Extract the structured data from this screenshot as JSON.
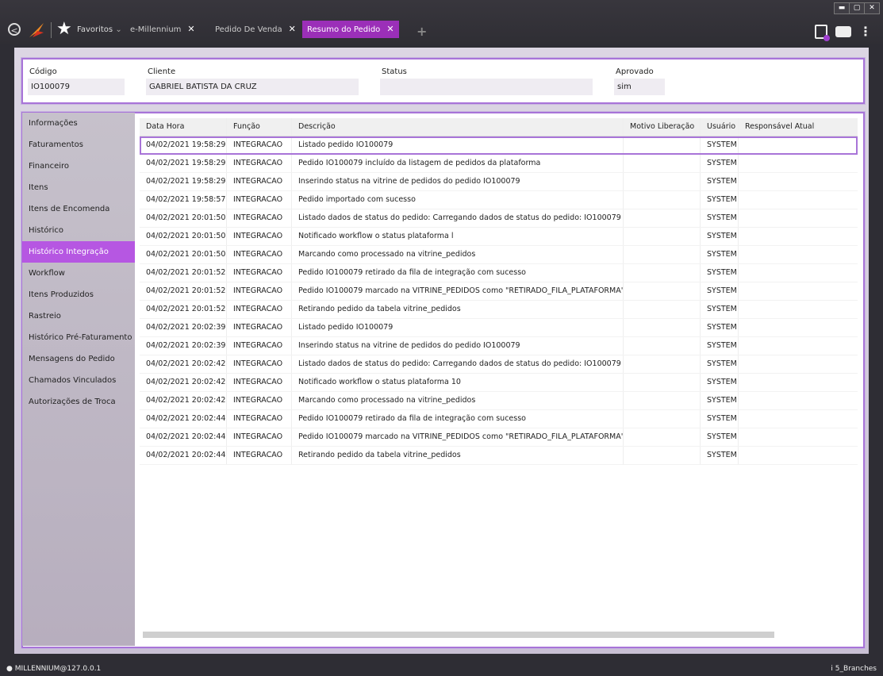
{
  "topbar": {
    "back": "⊖",
    "favorites": {
      "label": "Favoritos",
      "caret": "⌄"
    },
    "tabs": [
      {
        "label": "e-Millennium",
        "close": "✕"
      },
      {
        "label": "Pedido De Venda",
        "close": "✕"
      },
      {
        "label": "Resumo do Pedido",
        "close": "✕"
      }
    ],
    "add_tab": "+",
    "window_controls": [
      "▬",
      "▢",
      "✕"
    ],
    "menu_dots": "⋮"
  },
  "header": {
    "codigo_label": "Código",
    "codigo_value": "IO100079",
    "cliente_label": "Cliente",
    "cliente_value": "GABRIEL BATISTA DA CRUZ",
    "status_label": "Status",
    "status_value": "",
    "aprovado_label": "Aprovado",
    "aprovado_value": "sim"
  },
  "sidebar": {
    "items": [
      "Informações",
      "Faturamentos",
      "Financeiro",
      "Itens",
      "Itens de Encomenda",
      "Histórico",
      "Histórico Integração",
      "Workflow",
      "Itens Produzidos",
      "Rastreio",
      "Histórico Pré-Faturamento",
      "Mensagens do Pedido",
      "Chamados Vinculados",
      "Autorizações de Troca"
    ],
    "active_index": 6
  },
  "grid": {
    "columns": [
      "Data Hora",
      "Função",
      "Descrição",
      "Motivo Liberação",
      "Usuário",
      "Responsável Atual"
    ],
    "rows": [
      [
        "04/02/2021 19:58:29",
        "INTEGRACAO",
        "Listado pedido IO100079",
        "",
        "SYSTEM",
        ""
      ],
      [
        "04/02/2021 19:58:29",
        "INTEGRACAO",
        "Pedido IO100079 incluído da listagem de pedidos da plataforma",
        "",
        "SYSTEM",
        ""
      ],
      [
        "04/02/2021 19:58:29",
        "INTEGRACAO",
        "Inserindo status na vitrine de pedidos do pedido IO100079",
        "",
        "SYSTEM",
        ""
      ],
      [
        "04/02/2021 19:58:57",
        "INTEGRACAO",
        "Pedido importado com sucesso",
        "",
        "SYSTEM",
        ""
      ],
      [
        "04/02/2021 20:01:50",
        "INTEGRACAO",
        "Listado dados de status do pedido: Carregando dados de status do pedido: IO100079",
        "",
        "SYSTEM",
        ""
      ],
      [
        "04/02/2021 20:01:50",
        "INTEGRACAO",
        "Notificado workflow o status plataforma l",
        "",
        "SYSTEM",
        ""
      ],
      [
        "04/02/2021 20:01:50",
        "INTEGRACAO",
        "Marcando como processado na vitrine_pedidos",
        "",
        "SYSTEM",
        ""
      ],
      [
        "04/02/2021 20:01:52",
        "INTEGRACAO",
        "Pedido IO100079 retirado da fila de integração com sucesso",
        "",
        "SYSTEM",
        ""
      ],
      [
        "04/02/2021 20:01:52",
        "INTEGRACAO",
        "Pedido IO100079 marcado na VITRINE_PEDIDOS como \"RETIRADO_FILA_PLATAFORMA\"",
        "",
        "SYSTEM",
        ""
      ],
      [
        "04/02/2021 20:01:52",
        "INTEGRACAO",
        "Retirando pedido da tabela vitrine_pedidos",
        "",
        "SYSTEM",
        ""
      ],
      [
        "04/02/2021 20:02:39",
        "INTEGRACAO",
        "Listado pedido IO100079",
        "",
        "SYSTEM",
        ""
      ],
      [
        "04/02/2021 20:02:39",
        "INTEGRACAO",
        "Inserindo status na vitrine de pedidos do pedido IO100079",
        "",
        "SYSTEM",
        ""
      ],
      [
        "04/02/2021 20:02:42",
        "INTEGRACAO",
        "Listado dados de status do pedido: Carregando dados de status do pedido: IO100079",
        "",
        "SYSTEM",
        ""
      ],
      [
        "04/02/2021 20:02:42",
        "INTEGRACAO",
        "Notificado workflow o status plataforma 10",
        "",
        "SYSTEM",
        ""
      ],
      [
        "04/02/2021 20:02:42",
        "INTEGRACAO",
        "Marcando como processado na vitrine_pedidos",
        "",
        "SYSTEM",
        ""
      ],
      [
        "04/02/2021 20:02:44",
        "INTEGRACAO",
        "Pedido IO100079 retirado da fila de integração com sucesso",
        "",
        "SYSTEM",
        ""
      ],
      [
        "04/02/2021 20:02:44",
        "INTEGRACAO",
        "Pedido IO100079 marcado na VITRINE_PEDIDOS como \"RETIRADO_FILA_PLATAFORMA\"",
        "",
        "SYSTEM",
        ""
      ],
      [
        "04/02/2021 20:02:44",
        "INTEGRACAO",
        "Retirando pedido da tabela vitrine_pedidos",
        "",
        "SYSTEM",
        ""
      ]
    ],
    "selected_index": 0
  },
  "statusbar": {
    "user": "MILLENNIUM@127.0.0.1",
    "branch": "5_Branches"
  },
  "colors": {
    "accent": "#9b2fb8",
    "sidebar_active": "#b657e2",
    "panel_border": "#a874d8"
  }
}
